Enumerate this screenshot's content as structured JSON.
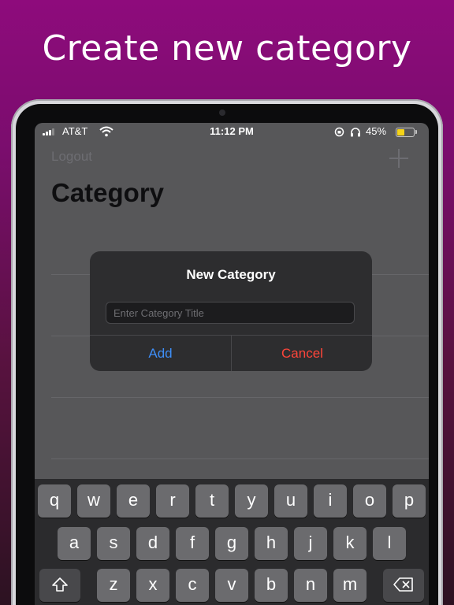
{
  "headline": "Create new category",
  "status_bar": {
    "carrier": "AT&T",
    "time": "11:12 PM",
    "battery_percent": "45%",
    "battery_level": 0.45,
    "battery_color": "#f5d317",
    "icons": [
      "signal-icon",
      "wifi-icon",
      "orientation-lock-icon",
      "headphones-icon",
      "battery-icon"
    ]
  },
  "nav": {
    "logout_label": "Logout",
    "add_icon": "plus-icon"
  },
  "page_title": "Category",
  "alert": {
    "title": "New Category",
    "input_placeholder": "Enter Category Title",
    "input_value": "",
    "add_label": "Add",
    "add_color": "#3e8ef7",
    "cancel_label": "Cancel",
    "cancel_color": "#ff453a"
  },
  "keyboard": {
    "row1": [
      "q",
      "w",
      "e",
      "r",
      "t",
      "y",
      "u",
      "i",
      "o",
      "p"
    ],
    "row2": [
      "a",
      "s",
      "d",
      "f",
      "g",
      "h",
      "j",
      "k",
      "l"
    ],
    "row3": [
      "z",
      "x",
      "c",
      "v",
      "b",
      "n",
      "m"
    ],
    "shift_icon": "shift-icon",
    "delete_icon": "backspace-icon"
  }
}
